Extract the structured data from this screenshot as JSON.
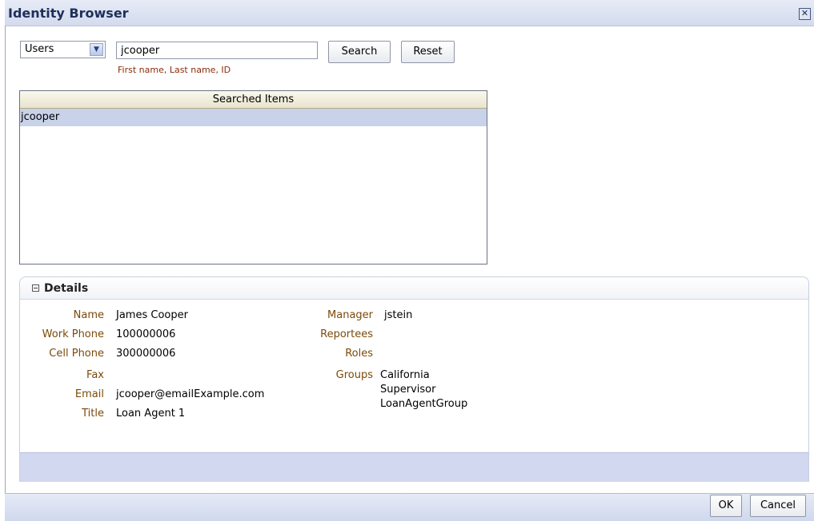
{
  "dialog": {
    "title": "Identity Browser",
    "close_icon": "close-icon"
  },
  "search": {
    "type_value": "Users",
    "query": "jcooper",
    "hint": "First name, Last name, ID",
    "search_label": "Search",
    "reset_label": "Reset"
  },
  "results": {
    "header": "Searched Items",
    "rows": [
      "jcooper"
    ]
  },
  "details": {
    "title": "Details",
    "left": [
      {
        "label": "Name",
        "value": "James Cooper"
      },
      {
        "label": "Work Phone",
        "value": "100000006"
      },
      {
        "label": "Cell Phone",
        "value": "300000006"
      },
      {
        "label": "Fax",
        "value": ""
      },
      {
        "label": "Email",
        "value": "jcooper@emailExample.com"
      },
      {
        "label": "Title",
        "value": "Loan Agent 1"
      }
    ],
    "right": [
      {
        "label": "Manager",
        "value": "jstein"
      },
      {
        "label": "Reportees",
        "value": ""
      },
      {
        "label": "Roles",
        "value": ""
      },
      {
        "label": "Groups",
        "values": [
          "California",
          "Supervisor",
          "LoanAgentGroup"
        ]
      }
    ]
  },
  "footer": {
    "ok_label": "OK",
    "cancel_label": "Cancel"
  },
  "colors": {
    "label": "#7b4a09",
    "hint": "#8a2c0a",
    "selected_row": "#c8d2e8",
    "title": "#1f2f5a"
  }
}
